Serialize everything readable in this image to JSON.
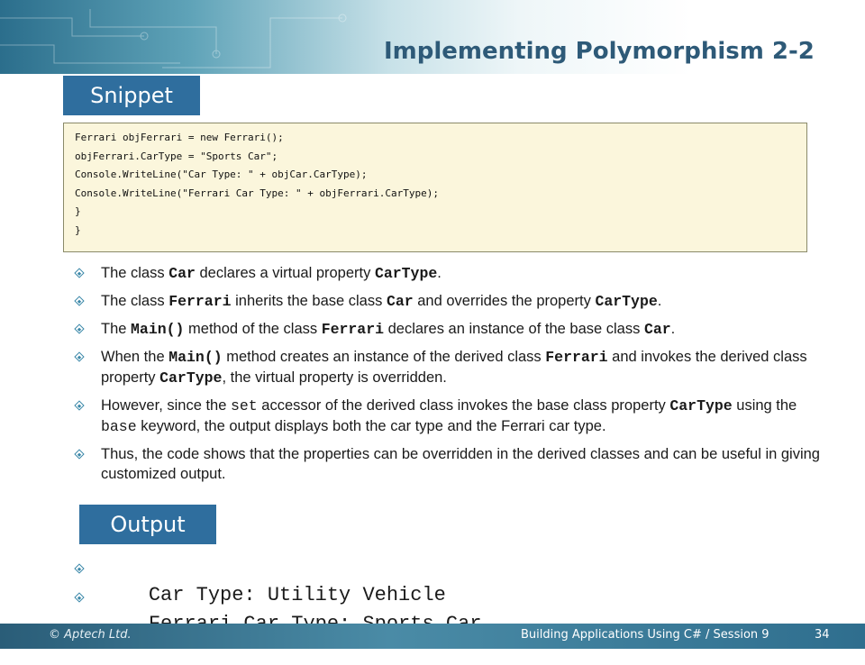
{
  "slide": {
    "title": "Implementing Polymorphism 2-2",
    "snippet_label": "Snippet",
    "output_label": "Output"
  },
  "code_lines": [
    "Ferrari objFerrari = new Ferrari();",
    "objFerrari.CarType = \"Sports Car\";",
    "Console.WriteLine(\"Car Type: \" + objCar.CarType);",
    "Console.WriteLine(\"Ferrari Car Type: \" + objFerrari.CarType);",
    "}",
    "}"
  ],
  "bullets": [
    {
      "parts": [
        {
          "t": "The class "
        },
        {
          "t": "Car",
          "s": "code"
        },
        {
          "t": " declares a virtual property "
        },
        {
          "t": "CarType",
          "s": "code"
        },
        {
          "t": "."
        }
      ]
    },
    {
      "parts": [
        {
          "t": "The class "
        },
        {
          "t": "Ferrari",
          "s": "code"
        },
        {
          "t": " inherits the base class "
        },
        {
          "t": "Car",
          "s": "code"
        },
        {
          "t": " and overrides the property "
        },
        {
          "t": "CarType",
          "s": "code"
        },
        {
          "t": "."
        }
      ]
    },
    {
      "parts": [
        {
          "t": "The "
        },
        {
          "t": "Main()",
          "s": "code"
        },
        {
          "t": " method of the class "
        },
        {
          "t": "Ferrari",
          "s": "code"
        },
        {
          "t": " declares an instance of the base class "
        },
        {
          "t": "Car",
          "s": "code"
        },
        {
          "t": "."
        }
      ]
    },
    {
      "parts": [
        {
          "t": "When the "
        },
        {
          "t": "Main()",
          "s": "code"
        },
        {
          "t": " method creates an instance of the derived class "
        },
        {
          "t": "Ferrari",
          "s": "code"
        },
        {
          "t": " and invokes the derived class property "
        },
        {
          "t": "CarType",
          "s": "code"
        },
        {
          "t": ", the virtual property is overridden."
        }
      ]
    },
    {
      "parts": [
        {
          "t": "However, since the "
        },
        {
          "t": "set",
          "s": "code-plain"
        },
        {
          "t": " accessor of the derived class invokes the base class property "
        },
        {
          "t": "CarType",
          "s": "code"
        },
        {
          "t": " using the "
        },
        {
          "t": "base",
          "s": "code-plain"
        },
        {
          "t": " keyword, the output displays both the car type and the Ferrari car type."
        }
      ]
    },
    {
      "parts": [
        {
          "t": "Thus, the code shows that the properties can be overridden in the derived classes and can be useful in giving customized output."
        }
      ]
    }
  ],
  "output_lines": [
    "Car Type: Utility Vehicle",
    "Ferrari Car Type: Sports Car"
  ],
  "footer": {
    "copyright": "© Aptech Ltd.",
    "course": "Building Applications Using C# / Session 9",
    "page_number": "34"
  },
  "colors": {
    "title": "#2e5a78",
    "label_bg": "#2f6e9e",
    "code_bg": "#fbf6dc",
    "bullet": "#3a87a8",
    "footer_bg": "#2f6e8e"
  },
  "icons": {
    "bullet": "diamond-bullet-icon"
  }
}
